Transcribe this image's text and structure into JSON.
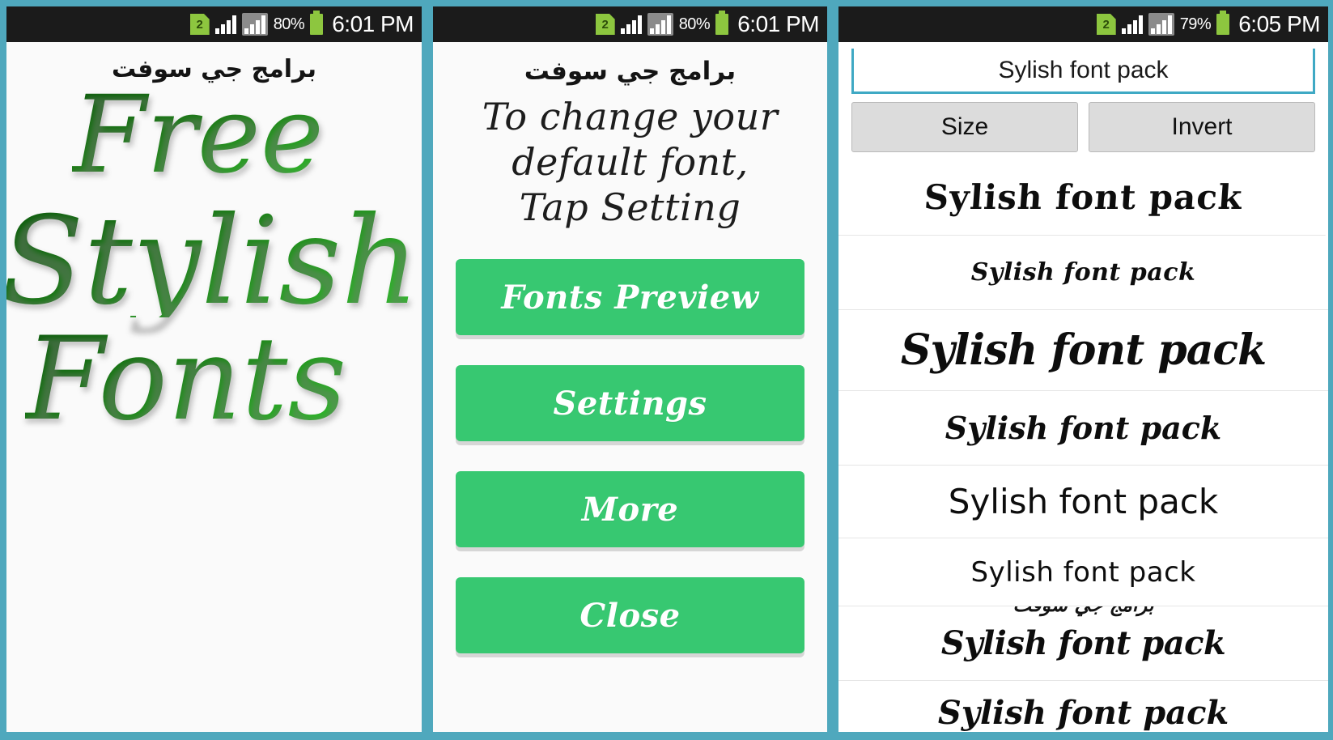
{
  "theme": {
    "frame_color": "#4FA8BD",
    "panel_bg": "#FAFAFA",
    "accent_green": "#37C871",
    "art_green": "#1a7a18",
    "statusbar_bg": "#1B1B1B",
    "gray_button": "#DCDCDC"
  },
  "panel1": {
    "statusbar": {
      "sim_badge": "2",
      "battery_percent": "80%",
      "time": "6:01 PM",
      "signal_icon": "signal-bars-icon",
      "signal2_icon": "signal-bars-boxed-icon",
      "battery_icon": "battery-icon"
    },
    "title_arabic": "برامج جي سوفت",
    "art_words": [
      "Free",
      "Stylish",
      "Fonts"
    ]
  },
  "panel2": {
    "statusbar": {
      "sim_badge": "2",
      "battery_percent": "80%",
      "time": "6:01 PM",
      "signal_icon": "signal-bars-icon",
      "signal2_icon": "signal-bars-boxed-icon",
      "battery_icon": "battery-icon"
    },
    "title_arabic": "برامج جي سوفت",
    "instruction_line1": "To change your default font,",
    "instruction_line2": "Tap Setting",
    "buttons": [
      {
        "label": "Fonts Preview"
      },
      {
        "label": "Settings"
      },
      {
        "label": "More"
      },
      {
        "label": "Close"
      }
    ]
  },
  "panel3": {
    "statusbar": {
      "sim_badge": "2",
      "battery_percent": "79%",
      "time": "6:05 PM",
      "signal_icon": "signal-bars-icon",
      "signal2_icon": "signal-bars-boxed-icon",
      "battery_icon": "battery-icon"
    },
    "search": {
      "value": "Sylish font pack",
      "placeholder": "Sylish font pack"
    },
    "toolbar": {
      "size_label": "Size",
      "invert_label": "Invert"
    },
    "font_rows": [
      {
        "text": "Sylish font pack"
      },
      {
        "text": "Sylish font pack"
      },
      {
        "text": "Sylish font pack"
      },
      {
        "text": "Sylish font pack"
      },
      {
        "text": "Sylish font pack"
      },
      {
        "text": "Sylish font pack"
      },
      {
        "text": "Sylish font pack",
        "overlay_arabic": "برامج جي سوفت"
      },
      {
        "text": "Sylish font pack"
      }
    ]
  }
}
